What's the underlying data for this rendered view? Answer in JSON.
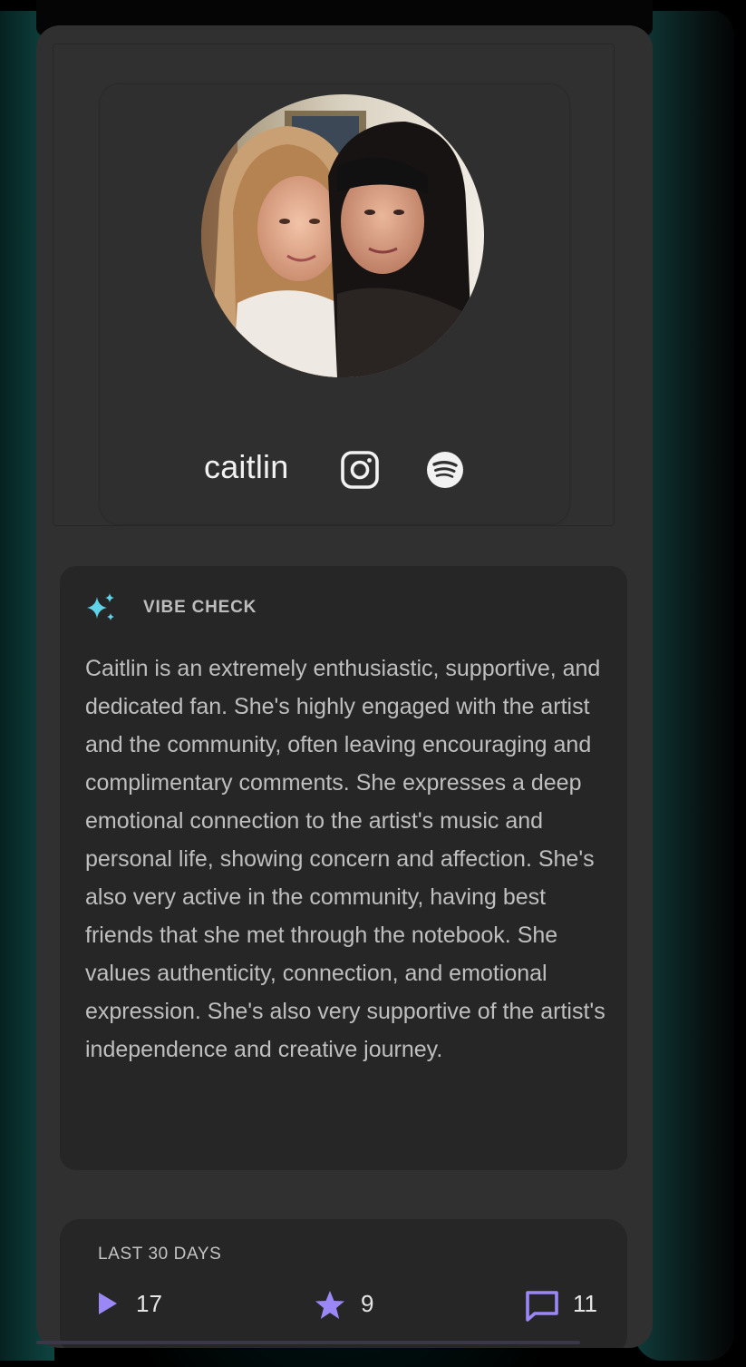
{
  "profile": {
    "username": "caitlin",
    "avatar_alt": "profile photo"
  },
  "icons": {
    "instagram": "instagram-icon",
    "spotify": "spotify-icon",
    "sparkle": "sparkle-icon",
    "play": "play-icon",
    "star": "star-icon",
    "comment": "comment-icon"
  },
  "vibe_check": {
    "title": "VIBE CHECK",
    "text": "Caitlin is an extremely enthusiastic, supportive, and dedicated fan. She's highly engaged with the artist and the community, often leaving encouraging and complimentary comments. She expresses a deep emotional connection to the artist's music and personal life, showing concern and affection. She's also very active in the community, having best friends that she met through the notebook. She values authenticity, connection, and emotional expression. She's also very supportive of the artist's independence and creative journey."
  },
  "stats": {
    "title": "LAST 30 DAYS",
    "plays": "17",
    "stars": "9",
    "comments": "11"
  },
  "colors": {
    "accent_purple": "#9b87f5",
    "sparkle_cyan": "#5fd3e8",
    "card_bg": "#303030",
    "panel_bg": "#262626"
  }
}
